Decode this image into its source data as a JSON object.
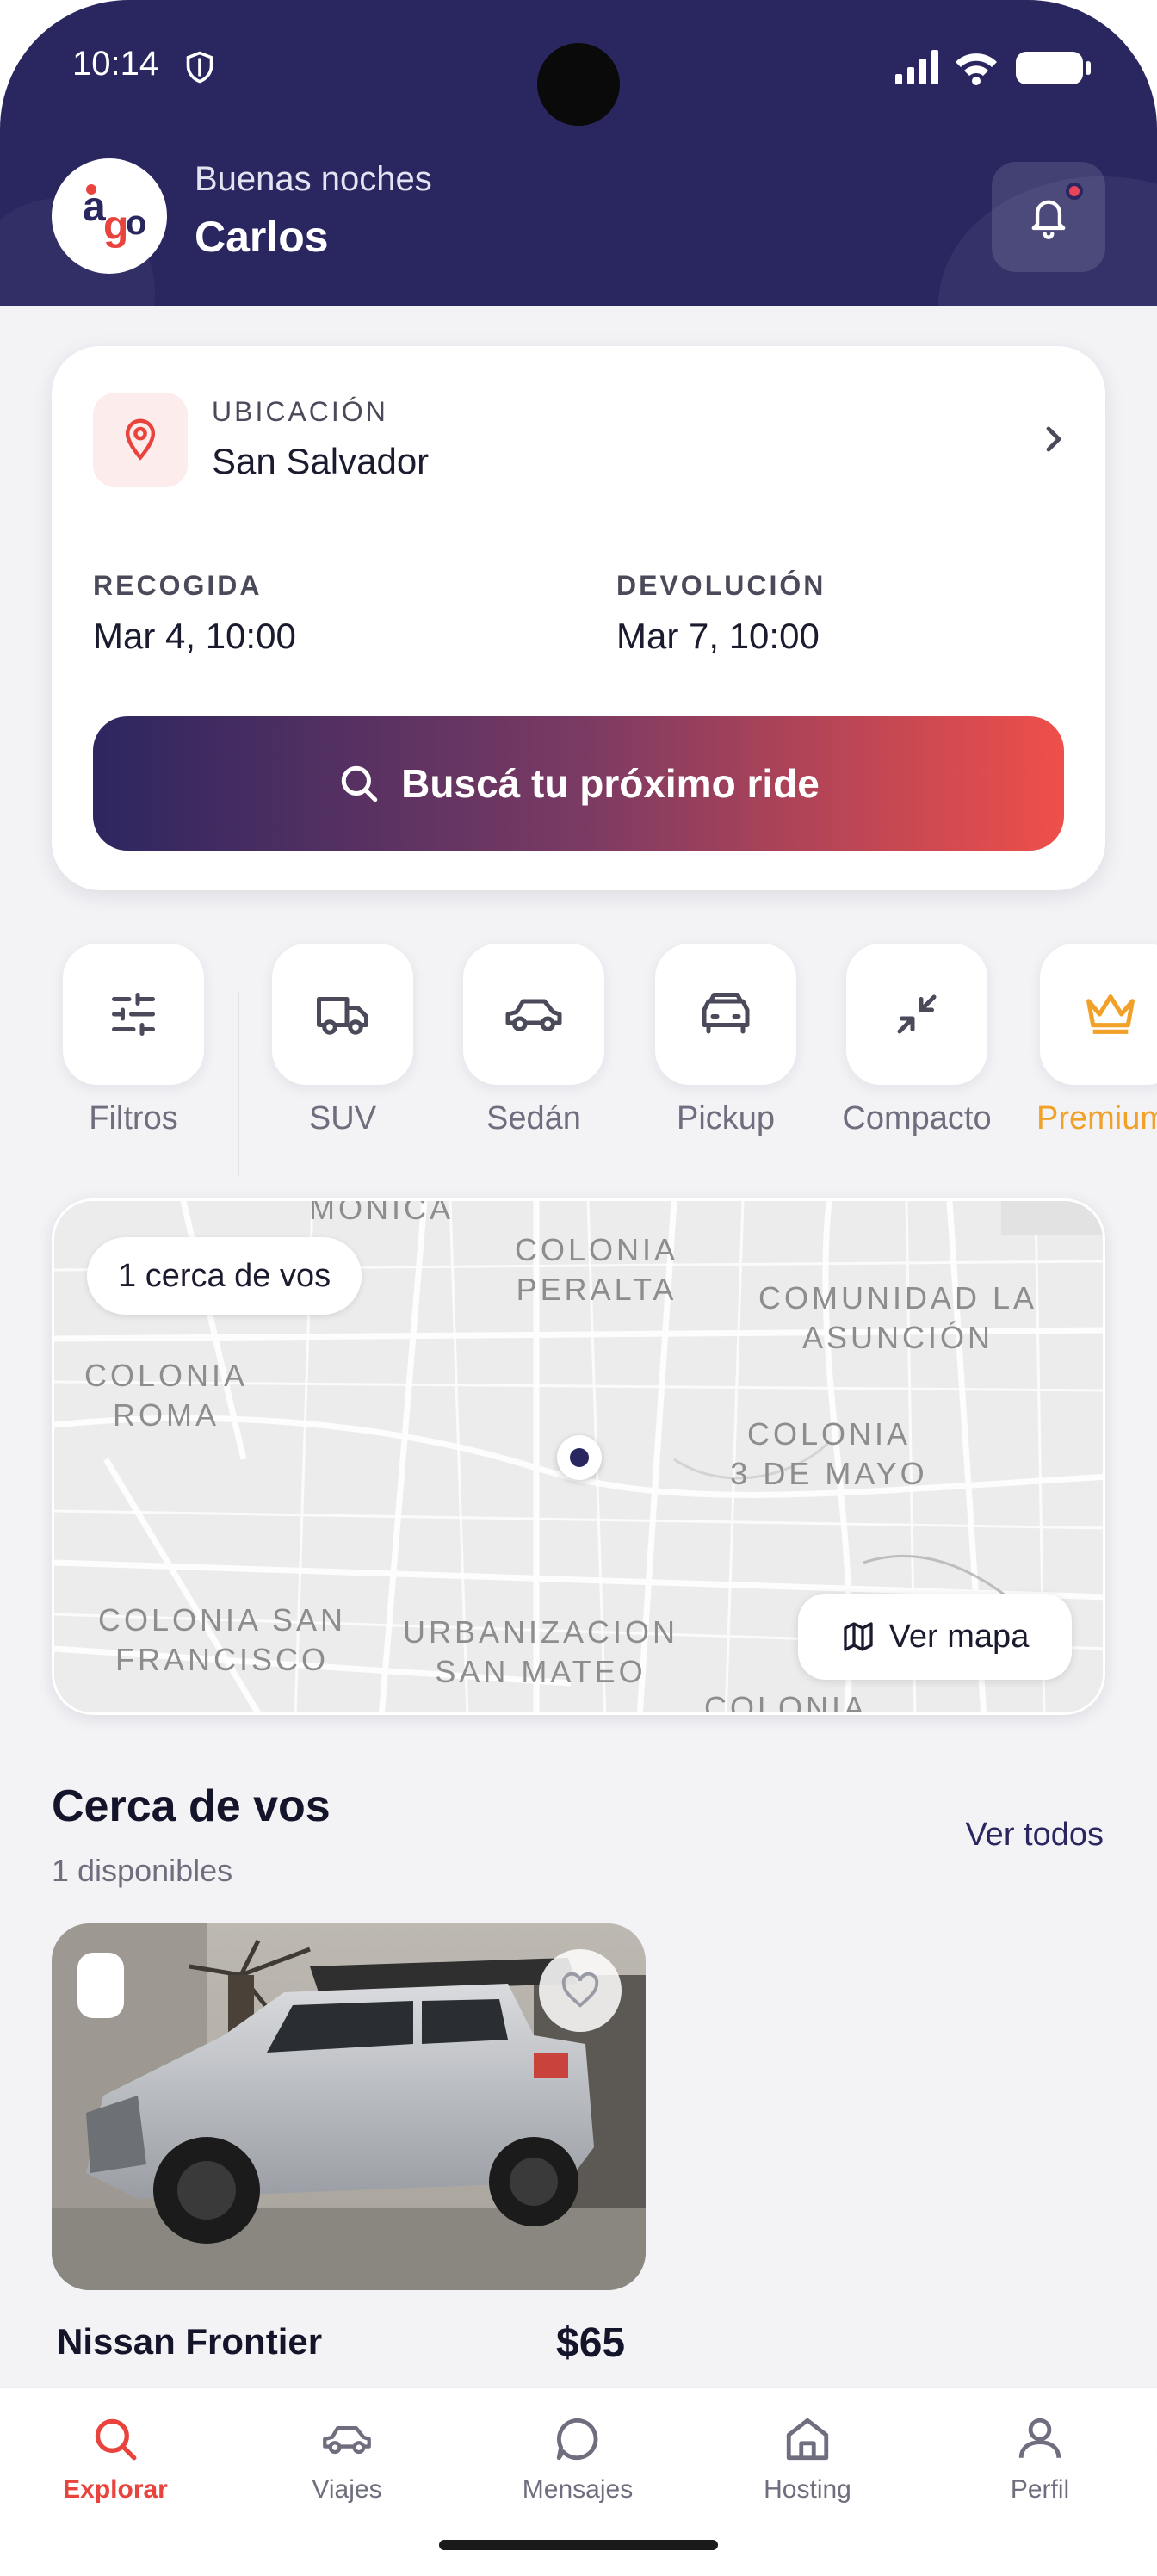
{
  "status_bar": {
    "time": "10:14"
  },
  "header": {
    "greeting": "Buenas noches",
    "username": "Carlos",
    "notification_unread": true
  },
  "search_card": {
    "location_label": "UBICACIÓN",
    "location_value": "San Salvador",
    "pickup_label": "RECOGIDA",
    "pickup_value": "Mar 4, 10:00",
    "return_label": "DEVOLUCIÓN",
    "return_value": "Mar 7, 10:00",
    "search_button": "Buscá tu próximo ride"
  },
  "categories": [
    {
      "label": "Filtros",
      "icon": "sliders-icon"
    },
    {
      "label": "SUV",
      "icon": "truck-icon"
    },
    {
      "label": "Sedán",
      "icon": "car-icon"
    },
    {
      "label": "Pickup",
      "icon": "pickup-icon"
    },
    {
      "label": "Compacto",
      "icon": "minimize-icon"
    },
    {
      "label": "Premium",
      "icon": "crown-icon"
    }
  ],
  "map": {
    "chip": "1 cerca de vos",
    "button": "Ver mapa",
    "labels": {
      "monica": "MONICA",
      "peralta": "COLONIA\nPERALTA",
      "asuncion": "COMUNIDAD LA\nASUNCIÓN",
      "roma": "COLONIA\nROMA",
      "tresmayo": "COLONIA\n3 DE MAYO",
      "sanfrancisco": "COLONIA SAN\nFRANCISCO",
      "sanmateo": "URBANIZACION\nSAN MATEO",
      "colonia_bottom": "COLONIA"
    }
  },
  "nearby": {
    "title": "Cerca de vos",
    "subtitle": "1 disponibles",
    "see_all": "Ver todos",
    "cars": [
      {
        "name": "Nissan Frontier",
        "price": "$65"
      }
    ]
  },
  "bottom_nav": {
    "items": [
      {
        "label": "Explorar",
        "active": true
      },
      {
        "label": "Viajes",
        "active": false
      },
      {
        "label": "Mensajes",
        "active": false
      },
      {
        "label": "Hosting",
        "active": false
      },
      {
        "label": "Perfil",
        "active": false
      }
    ]
  },
  "colors": {
    "brand": "#2a2760",
    "accent": "#e9433d",
    "premium": "#f2a128"
  }
}
